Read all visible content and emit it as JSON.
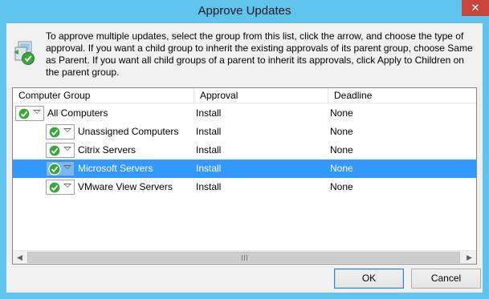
{
  "window": {
    "title": "Approve Updates",
    "close_glyph": "✕"
  },
  "intro_text": "To approve multiple updates, select the group from this list, click the arrow, and choose the type of approval. If you want a child group to inherit the existing approvals of its parent group, choose Same as Parent. If you want all child groups of a parent to inherit its approvals, click Apply to Children on the parent group.",
  "columns": [
    "Computer Group",
    "Approval",
    "Deadline"
  ],
  "rows": [
    {
      "group": "All Computers",
      "approval": "Install",
      "deadline": "None",
      "level": 0,
      "selected": false
    },
    {
      "group": "Unassigned Computers",
      "approval": "Install",
      "deadline": "None",
      "level": 1,
      "selected": false
    },
    {
      "group": "Citrix Servers",
      "approval": "Install",
      "deadline": "None",
      "level": 1,
      "selected": false
    },
    {
      "group": "Microsoft Servers",
      "approval": "Install",
      "deadline": "None",
      "level": 1,
      "selected": true
    },
    {
      "group": "VMware View Servers",
      "approval": "Install",
      "deadline": "None",
      "level": 1,
      "selected": false
    }
  ],
  "scrollbar": {
    "left_arrow": "◀",
    "right_arrow": "▶"
  },
  "buttons": {
    "ok": "OK",
    "cancel": "Cancel"
  },
  "colors": {
    "title_bar": "#5fc3ee",
    "selection": "#3399ff",
    "close": "#c7463d",
    "approved_icon": "#3aa53a"
  },
  "icons": {
    "header": "approve-updates-icon",
    "status": "approved-checkmark-icon"
  }
}
